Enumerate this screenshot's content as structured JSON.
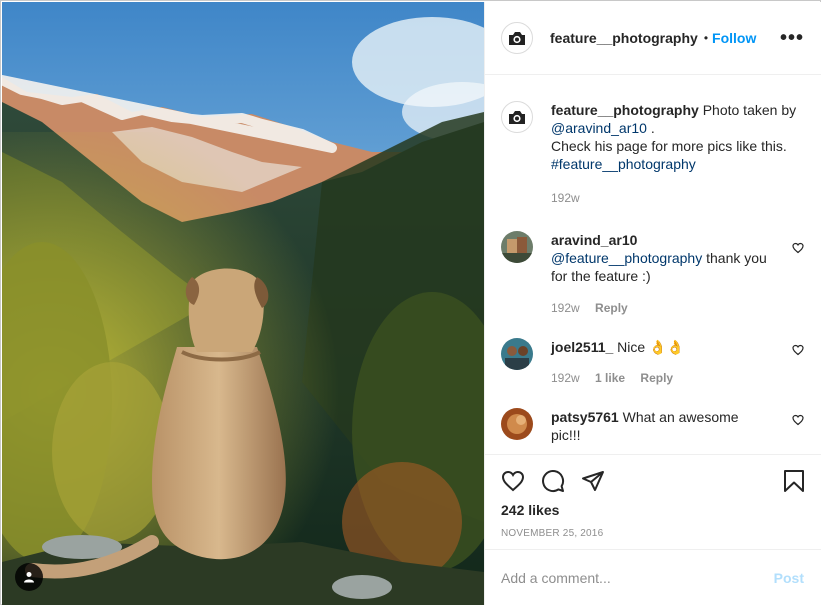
{
  "post": {
    "username": "feature__photography",
    "follow_label": "Follow",
    "dot": "•",
    "more_label": "•••"
  },
  "caption": {
    "username": "feature__photography",
    "text_1": "Photo taken by ",
    "mention": "@aravind_ar10",
    "text_2": " .",
    "text_3": "Check his page for more pics like this.",
    "hashtag": "#feature__photography",
    "time": "192w"
  },
  "comments": [
    {
      "username": "aravind_ar10",
      "mention": "@feature__photography",
      "text": " thank you for the feature :)",
      "time": "192w",
      "reply_label": "Reply",
      "likes": ""
    },
    {
      "username": "joel2511_",
      "text": " Nice 👌👌",
      "time": "192w",
      "likes": "1 like",
      "reply_label": "Reply"
    },
    {
      "username": "patsy5761",
      "text": " What an awesome pic!!!"
    }
  ],
  "actions": {
    "likes": "242 likes",
    "date": "NOVEMBER 25, 2016"
  },
  "add_comment": {
    "placeholder": "Add a comment...",
    "post_label": "Post"
  },
  "colors": {
    "accent": "#0095f6",
    "link": "#00376b",
    "muted": "#8e8e8e",
    "post_disabled": "#b2dffc"
  },
  "icons": [
    "user-tag-icon",
    "heart-icon",
    "comment-icon",
    "share-icon",
    "bookmark-icon",
    "more-icon"
  ]
}
